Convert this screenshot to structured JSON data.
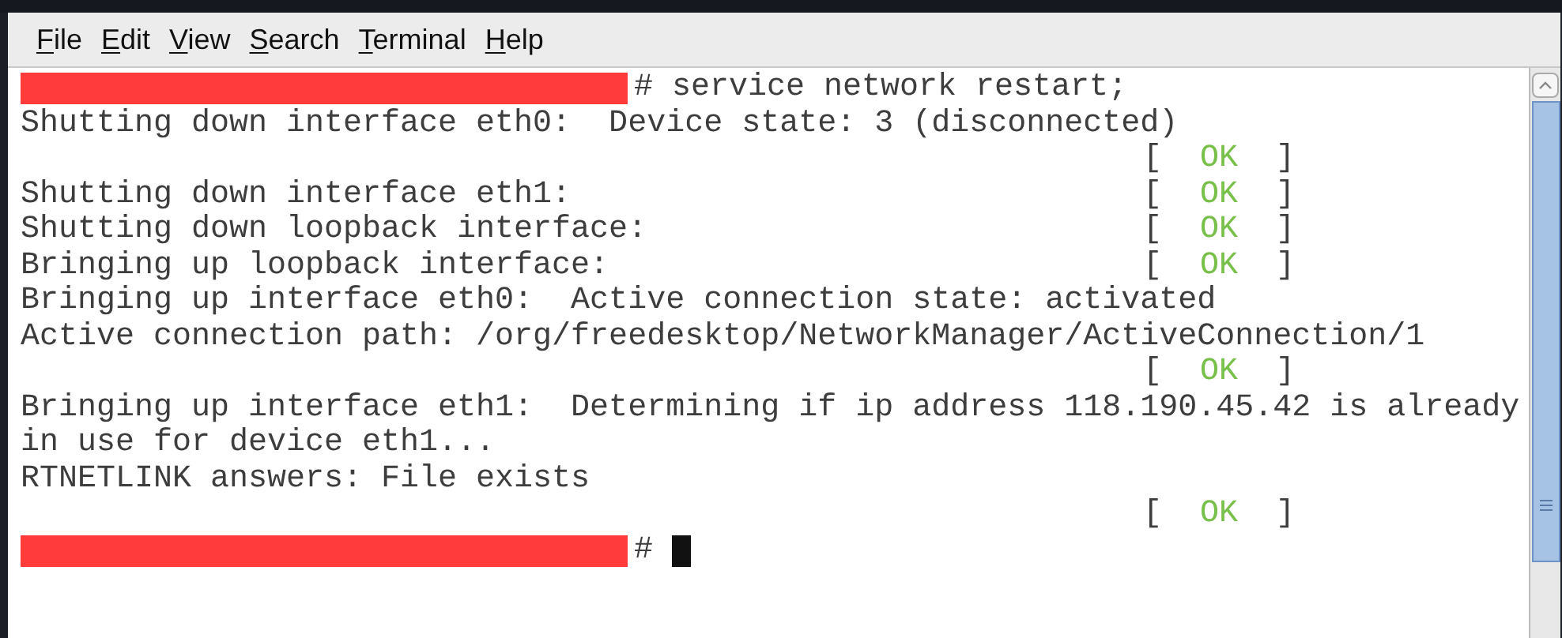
{
  "menu": [
    "File",
    "Edit",
    "View",
    "Search",
    "Terminal",
    "Help"
  ],
  "lines": [
    {
      "kind": "prompt",
      "redacted": true,
      "text": "# service network restart;",
      "cursor": false
    },
    {
      "kind": "text",
      "text": "Shutting down interface eth0:  Device state: 3 (disconnected)"
    },
    {
      "kind": "text",
      "status": {
        "left": "[",
        "word": "OK",
        "right": "]"
      }
    },
    {
      "kind": "text",
      "text": "Shutting down interface eth1:",
      "status": {
        "left": "[",
        "word": "OK",
        "right": "]"
      }
    },
    {
      "kind": "text",
      "text": "Shutting down loopback interface:",
      "status": {
        "left": "[",
        "word": "OK",
        "right": "]"
      }
    },
    {
      "kind": "text",
      "text": "Bringing up loopback interface:",
      "status": {
        "left": "[",
        "word": "OK",
        "right": "]"
      }
    },
    {
      "kind": "text",
      "text": "Bringing up interface eth0:  Active connection state: activated"
    },
    {
      "kind": "text",
      "text": "Active connection path: /org/freedesktop/NetworkManager/ActiveConnection/1"
    },
    {
      "kind": "text",
      "status": {
        "left": "[",
        "word": "OK",
        "right": "]"
      }
    },
    {
      "kind": "text",
      "text": "Bringing up interface eth1:  Determining if ip address 118.190.45.42 is already"
    },
    {
      "kind": "text",
      "text": "in use for device eth1..."
    },
    {
      "kind": "text",
      "text": "RTNETLINK answers: File exists"
    },
    {
      "kind": "text",
      "status": {
        "left": "[",
        "word": "OK",
        "right": "]"
      }
    },
    {
      "kind": "prompt",
      "redacted": true,
      "text": "#",
      "cursor": true
    }
  ]
}
